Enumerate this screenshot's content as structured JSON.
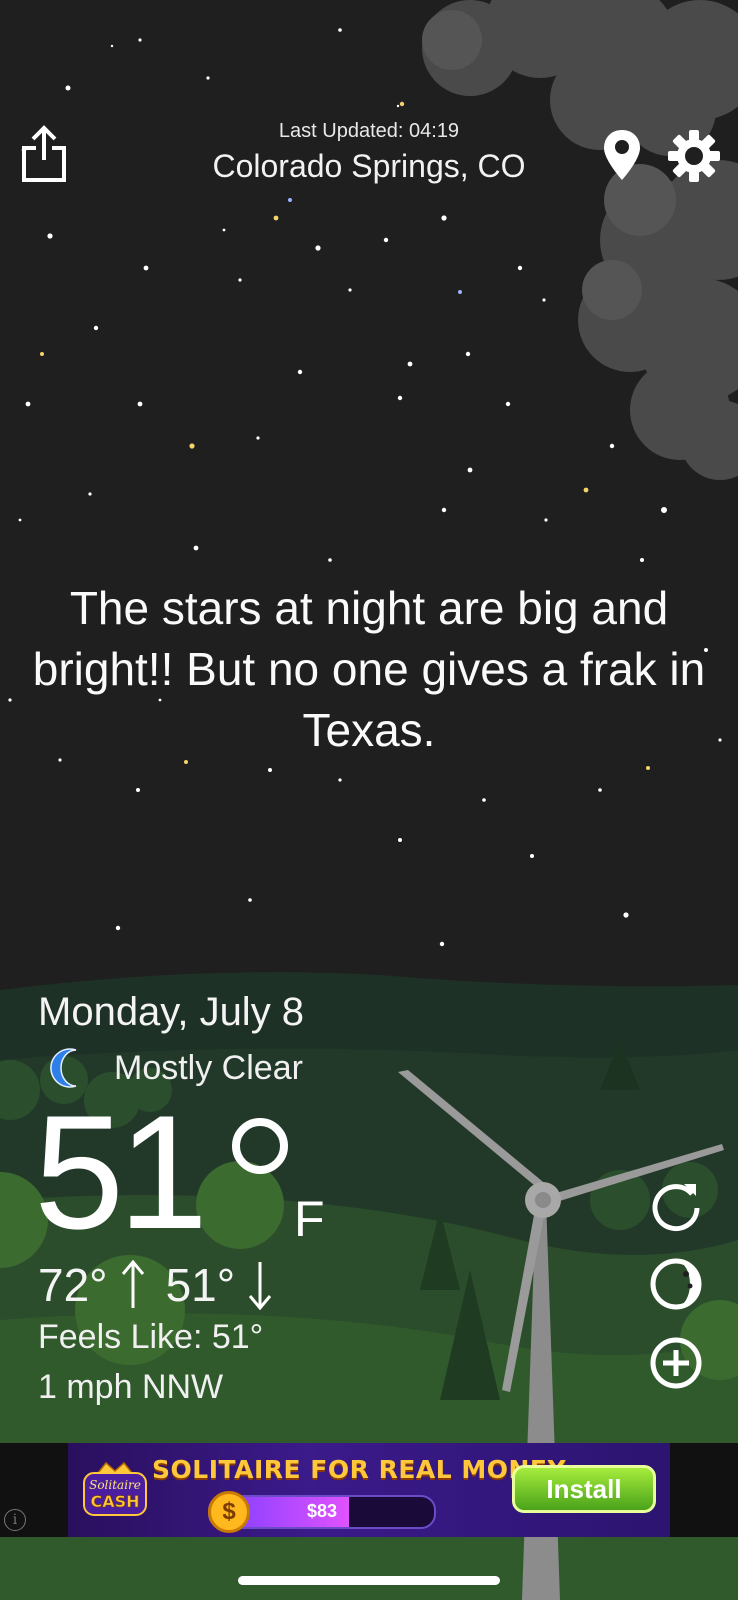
{
  "header": {
    "last_updated": "Last Updated: 04:19",
    "city": "Colorado Springs, CO",
    "share_icon": "share-icon",
    "location_icon": "location-pin-icon",
    "settings_icon": "gear-icon"
  },
  "quote": "The stars at night are big and bright!! But no one gives a frak in Texas.",
  "weather": {
    "date": "Monday, July 8",
    "condition_icon": "crescent-moon-icon",
    "condition": "Mostly Clear",
    "temperature": "51",
    "unit": "F",
    "high": "72°",
    "low": "51°",
    "feels_like": "Feels Like: 51°",
    "wind": "1 mph NNW"
  },
  "side_actions": [
    {
      "name": "refresh-icon"
    },
    {
      "name": "moon-phase-icon"
    },
    {
      "name": "add-icon"
    }
  ],
  "ad": {
    "logo_text": "Solitaire CASH",
    "headline": "SOLITAIRE FOR REAL MONEY",
    "amount": "$83",
    "progress": 0.62,
    "install_label": "Install",
    "info_icon": "i"
  },
  "colors": {
    "sky": "#1f1f1f",
    "hill_dark": "#1e2f24",
    "hill_light": "#2f5a2c",
    "moon": "#2f7fe8",
    "ad_green": "#6cc72a"
  }
}
